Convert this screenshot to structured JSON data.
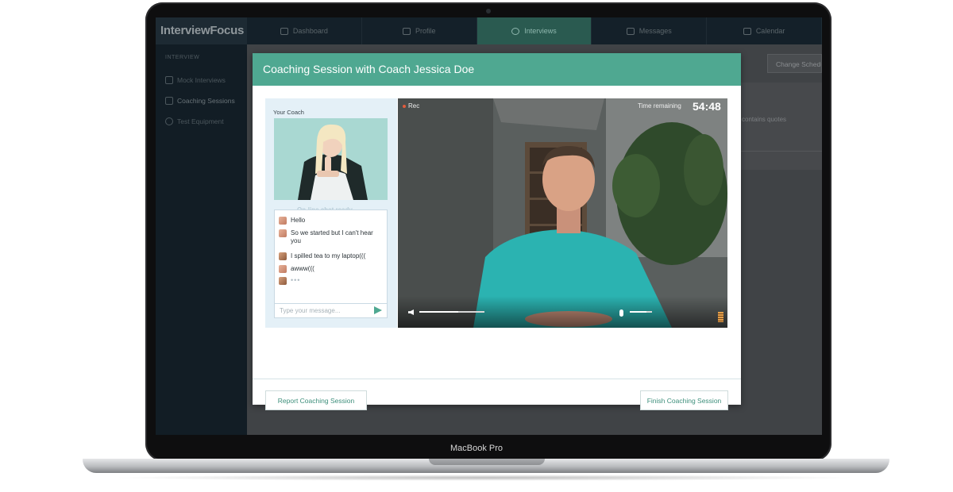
{
  "device": {
    "brand_label": "MacBook Pro"
  },
  "app": {
    "logo_text": "InterviewFocus",
    "nav": [
      {
        "label": "Dashboard",
        "icon": "dashboard-icon"
      },
      {
        "label": "Profile",
        "icon": "profile-icon"
      },
      {
        "label": "Interviews",
        "icon": "interviews-icon",
        "active": true
      },
      {
        "label": "Messages",
        "icon": "messages-icon"
      },
      {
        "label": "Calendar",
        "icon": "calendar-icon"
      }
    ],
    "sidebar": {
      "section": "INTERVIEW",
      "items": [
        {
          "label": "Mock Interviews",
          "icon": "document-icon"
        },
        {
          "label": "Coaching Sessions",
          "icon": "coaching-icon",
          "active": true
        },
        {
          "label": "Test Equipment",
          "icon": "webcam-icon"
        }
      ]
    },
    "background": {
      "change_button": "Change Schedule",
      "snippet_text": "contains quotes"
    }
  },
  "modal": {
    "title": "Coaching Session with Coach Jessica Doe",
    "coach_label": "Your Coach",
    "chat_status": "On-line chat ready",
    "messages": [
      {
        "sender": "coach",
        "text": "Hello"
      },
      {
        "sender": "coach",
        "text": "So we started but I can't hear you"
      },
      {
        "sender": "user",
        "text": "I spilled tea to my laptop((("
      },
      {
        "sender": "coach",
        "text": "awww((("
      },
      {
        "sender": "user",
        "text": "•••"
      }
    ],
    "chat_input_placeholder": "Type your message...",
    "video": {
      "rec_label": "Rec",
      "time_remaining_label": "Time remaining",
      "time_remaining_value": "54:48",
      "volume_level": 0.6,
      "mic_level": 0.75
    },
    "report_button": "Report Coaching Session",
    "finish_button": "Finish Coaching Session"
  },
  "colors": {
    "accent": "#4fa891",
    "nav_active": "#2a5a50",
    "rec_indicator": "#e25c3c"
  }
}
